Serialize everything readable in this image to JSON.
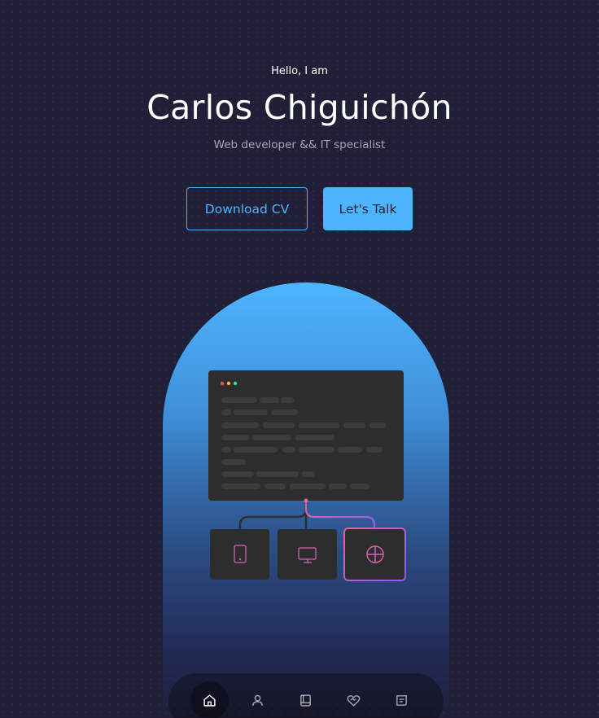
{
  "header": {
    "greeting": "Hello, I am",
    "name": "Carlos Chiguichón",
    "role": "Web developer && IT specialist"
  },
  "cta": {
    "download_label": "Download CV",
    "talk_label": "Let's Talk"
  },
  "colors": {
    "background": "#1f1f38",
    "primary": "#4db5ff",
    "accent_pink": "#e0659b",
    "accent_purple": "#8b5cf6"
  },
  "nav": {
    "items": [
      {
        "icon": "home-icon",
        "active": true
      },
      {
        "icon": "user-icon",
        "active": false
      },
      {
        "icon": "book-icon",
        "active": false
      },
      {
        "icon": "heart-handshake-icon",
        "active": false
      },
      {
        "icon": "message-icon",
        "active": false
      }
    ]
  }
}
